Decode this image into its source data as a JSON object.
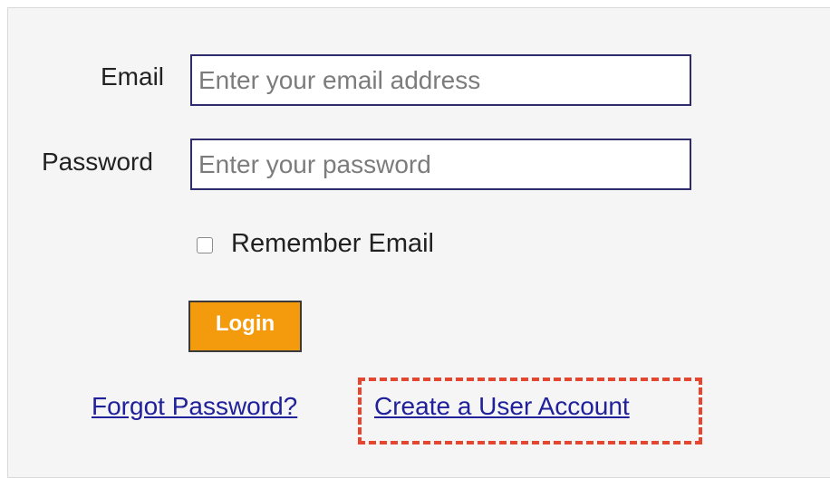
{
  "login_form": {
    "email_label": "Email",
    "email_placeholder": "Enter your email address",
    "email_value": "",
    "password_label": "Password",
    "password_placeholder": "Enter your password",
    "password_value": "",
    "remember_label": "Remember Email",
    "remember_checked": false,
    "login_label": "Login",
    "forgot_link": "Forgot Password?",
    "create_account_link": "Create a User Account"
  },
  "colors": {
    "panel_background": "#f5f5f5",
    "field_border": "#2f2c6e",
    "login_button": "#f39a0d",
    "link": "#20209a",
    "highlight": "#e8452e"
  }
}
